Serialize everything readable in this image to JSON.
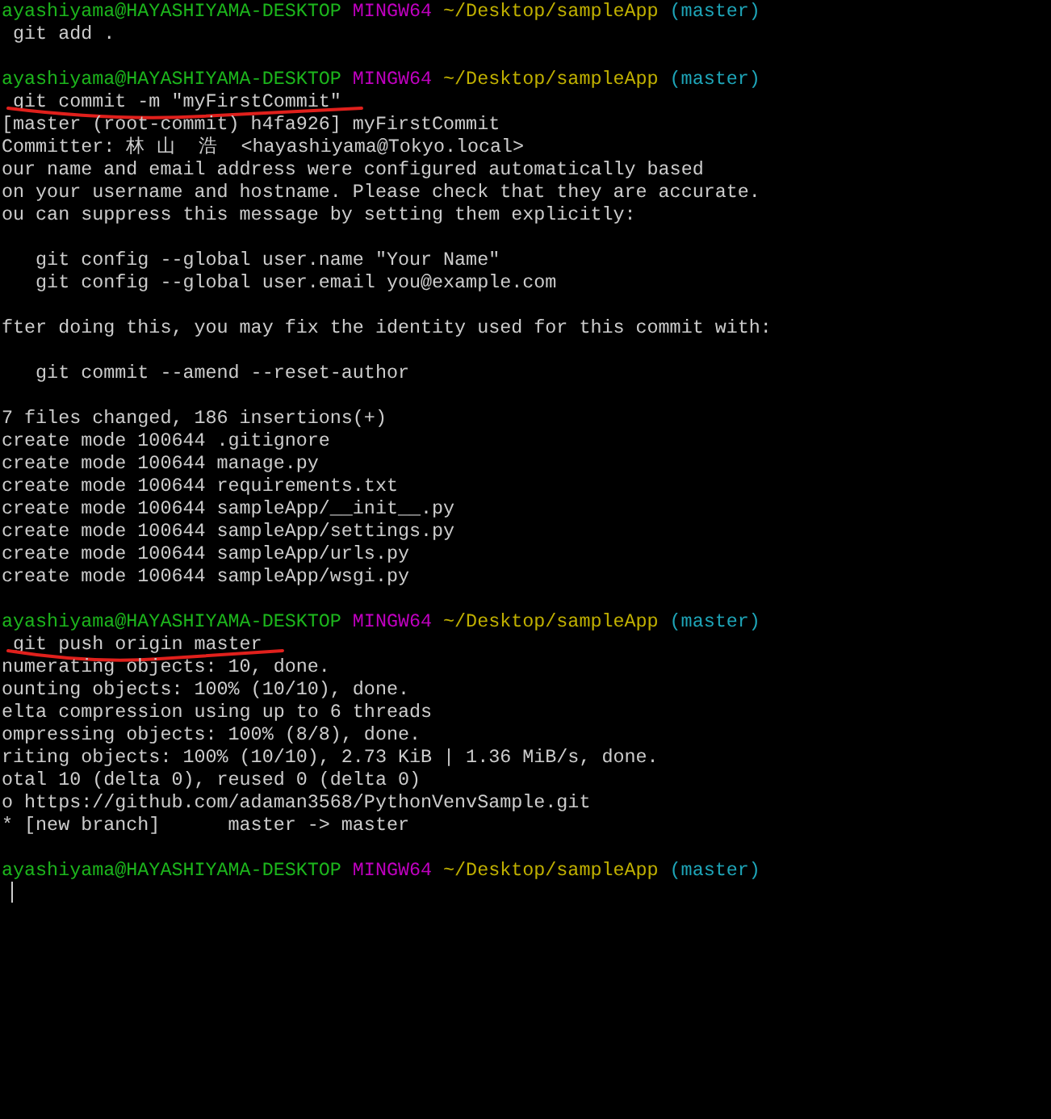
{
  "terminal": {
    "lines": [
      {
        "kind": "prompt",
        "user": "ayashiyama@HAYASHIYAMA-DESKTOP",
        "system": "MINGW64",
        "path": "~/Desktop/sampleApp",
        "branch": "(master)"
      },
      {
        "kind": "command",
        "text": "git add .",
        "scribbled": false
      },
      {
        "kind": "blank"
      },
      {
        "kind": "prompt",
        "user": "ayashiyama@HAYASHIYAMA-DESKTOP",
        "system": "MINGW64",
        "path": "~/Desktop/sampleApp",
        "branch": "(master)"
      },
      {
        "kind": "command",
        "text": "git commit -m \"myFirstCommit\"",
        "scribbled": true
      },
      {
        "kind": "output",
        "text": "[master (root-commit) h4fa926] myFirstCommit"
      },
      {
        "kind": "output",
        "text": "Committer: 林 山  浩  <hayashiyama@Tokyo.local>"
      },
      {
        "kind": "output",
        "text": "our name and email address were configured automatically based"
      },
      {
        "kind": "output",
        "text": "on your username and hostname. Please check that they are accurate."
      },
      {
        "kind": "output",
        "text": "ou can suppress this message by setting them explicitly:"
      },
      {
        "kind": "blank"
      },
      {
        "kind": "output",
        "text": "   git config --global user.name \"Your Name\""
      },
      {
        "kind": "output",
        "text": "   git config --global user.email you@example.com"
      },
      {
        "kind": "blank"
      },
      {
        "kind": "output",
        "text": "fter doing this, you may fix the identity used for this commit with:"
      },
      {
        "kind": "blank"
      },
      {
        "kind": "output",
        "text": "   git commit --amend --reset-author"
      },
      {
        "kind": "blank"
      },
      {
        "kind": "output",
        "text": "7 files changed, 186 insertions(+)"
      },
      {
        "kind": "output",
        "text": "create mode 100644 .gitignore"
      },
      {
        "kind": "output",
        "text": "create mode 100644 manage.py"
      },
      {
        "kind": "output",
        "text": "create mode 100644 requirements.txt"
      },
      {
        "kind": "output",
        "text": "create mode 100644 sampleApp/__init__.py"
      },
      {
        "kind": "output",
        "text": "create mode 100644 sampleApp/settings.py"
      },
      {
        "kind": "output",
        "text": "create mode 100644 sampleApp/urls.py"
      },
      {
        "kind": "output",
        "text": "create mode 100644 sampleApp/wsgi.py"
      },
      {
        "kind": "blank"
      },
      {
        "kind": "prompt",
        "user": "ayashiyama@HAYASHIYAMA-DESKTOP",
        "system": "MINGW64",
        "path": "~/Desktop/sampleApp",
        "branch": "(master)"
      },
      {
        "kind": "command",
        "text": "git push origin master",
        "scribbled": true
      },
      {
        "kind": "output",
        "text": "numerating objects: 10, done."
      },
      {
        "kind": "output",
        "text": "ounting objects: 100% (10/10), done."
      },
      {
        "kind": "output",
        "text": "elta compression using up to 6 threads"
      },
      {
        "kind": "output",
        "text": "ompressing objects: 100% (8/8), done."
      },
      {
        "kind": "output",
        "text": "riting objects: 100% (10/10), 2.73 KiB | 1.36 MiB/s, done."
      },
      {
        "kind": "output",
        "text": "otal 10 (delta 0), reused 0 (delta 0)"
      },
      {
        "kind": "output",
        "text": "o https://github.com/adaman3568/PythonVenvSample.git"
      },
      {
        "kind": "output",
        "text": "* [new branch]      master -> master"
      },
      {
        "kind": "blank"
      },
      {
        "kind": "prompt",
        "user": "ayashiyama@HAYASHIYAMA-DESKTOP",
        "system": "MINGW64",
        "path": "~/Desktop/sampleApp",
        "branch": "(master)"
      },
      {
        "kind": "cursor"
      }
    ]
  }
}
